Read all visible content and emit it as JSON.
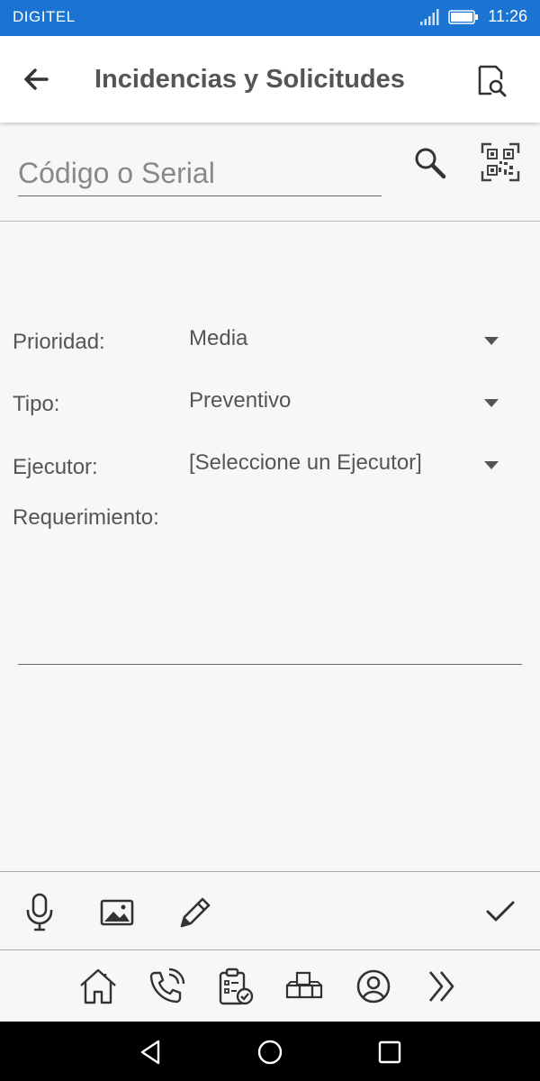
{
  "status_bar": {
    "carrier": "DIGITEL",
    "time": "11:26",
    "icons": [
      "signal-icon",
      "battery-icon"
    ]
  },
  "app_bar": {
    "title": "Incidencias y Solicitudes",
    "back_icon": "arrow-back-icon",
    "action_icon": "document-search-icon"
  },
  "search": {
    "placeholder": "Código o Serial",
    "value": "",
    "icons": [
      "search-icon",
      "qr-code-icon"
    ]
  },
  "form": {
    "prioridad": {
      "label": "Prioridad:",
      "value": "Media"
    },
    "tipo": {
      "label": "Tipo:",
      "value": "Preventivo"
    },
    "ejecutor": {
      "label": "Ejecutor:",
      "value": "[Seleccione un Ejecutor]"
    },
    "requerimiento": {
      "label": "Requerimiento:",
      "value": ""
    }
  },
  "toolbar": {
    "icons": [
      "microphone-icon",
      "image-icon",
      "pencil-icon",
      "check-icon"
    ]
  },
  "bottom_nav": {
    "icons": [
      "home-icon",
      "phone-call-icon",
      "clipboard-check-icon",
      "boxes-icon",
      "user-icon",
      "double-chevron-right-icon"
    ]
  },
  "system_nav": {
    "icons": [
      "back-triangle-icon",
      "home-circle-icon",
      "recents-square-icon"
    ]
  },
  "colors": {
    "status_bar": "#1b74d1",
    "text": "#555555",
    "background": "#f7f7f7"
  }
}
